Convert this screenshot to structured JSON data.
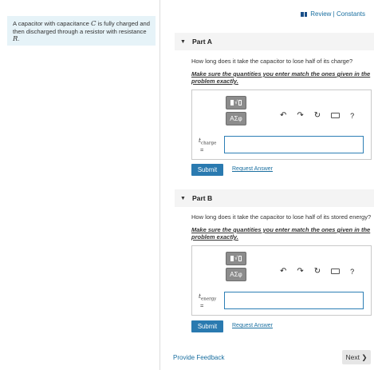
{
  "intro": {
    "text_1": "A capacitor with capacitance ",
    "var_c": "C",
    "text_2": " is fully charged and then discharged through a resistor with resistance ",
    "var_r": "R",
    "text_3": "."
  },
  "header": {
    "review_link": "Review | Constants"
  },
  "editor": {
    "greek_label": "ΑΣφ",
    "undo_icon": "↶",
    "redo_icon": "↷",
    "reset_icon": "↻",
    "help_icon": "?"
  },
  "part_a": {
    "title": "Part A",
    "question": "How long does it take the capacitor to lose half of its charge?",
    "instruction": "Make sure the quantities you enter match the ones given in the problem exactly.",
    "var_symbol": "t",
    "var_sub": "charge",
    "var_eq": "=",
    "input_value": "",
    "submit_label": "Submit",
    "request_label": "Request Answer"
  },
  "part_b": {
    "title": "Part B",
    "question": "How long does it take the capacitor to lose half of its stored energy?",
    "instruction": "Make sure the quantities you enter match the ones given in the problem exactly.",
    "var_symbol": "t",
    "var_sub": "energy",
    "var_eq": "=",
    "input_value": "",
    "submit_label": "Submit",
    "request_label": "Request Answer"
  },
  "footer": {
    "feedback_label": "Provide Feedback",
    "next_label": "Next ❯"
  },
  "colors": {
    "accent": "#2a7ab0",
    "intro_bg": "#e6f3f8",
    "link": "#1a6fa0"
  }
}
